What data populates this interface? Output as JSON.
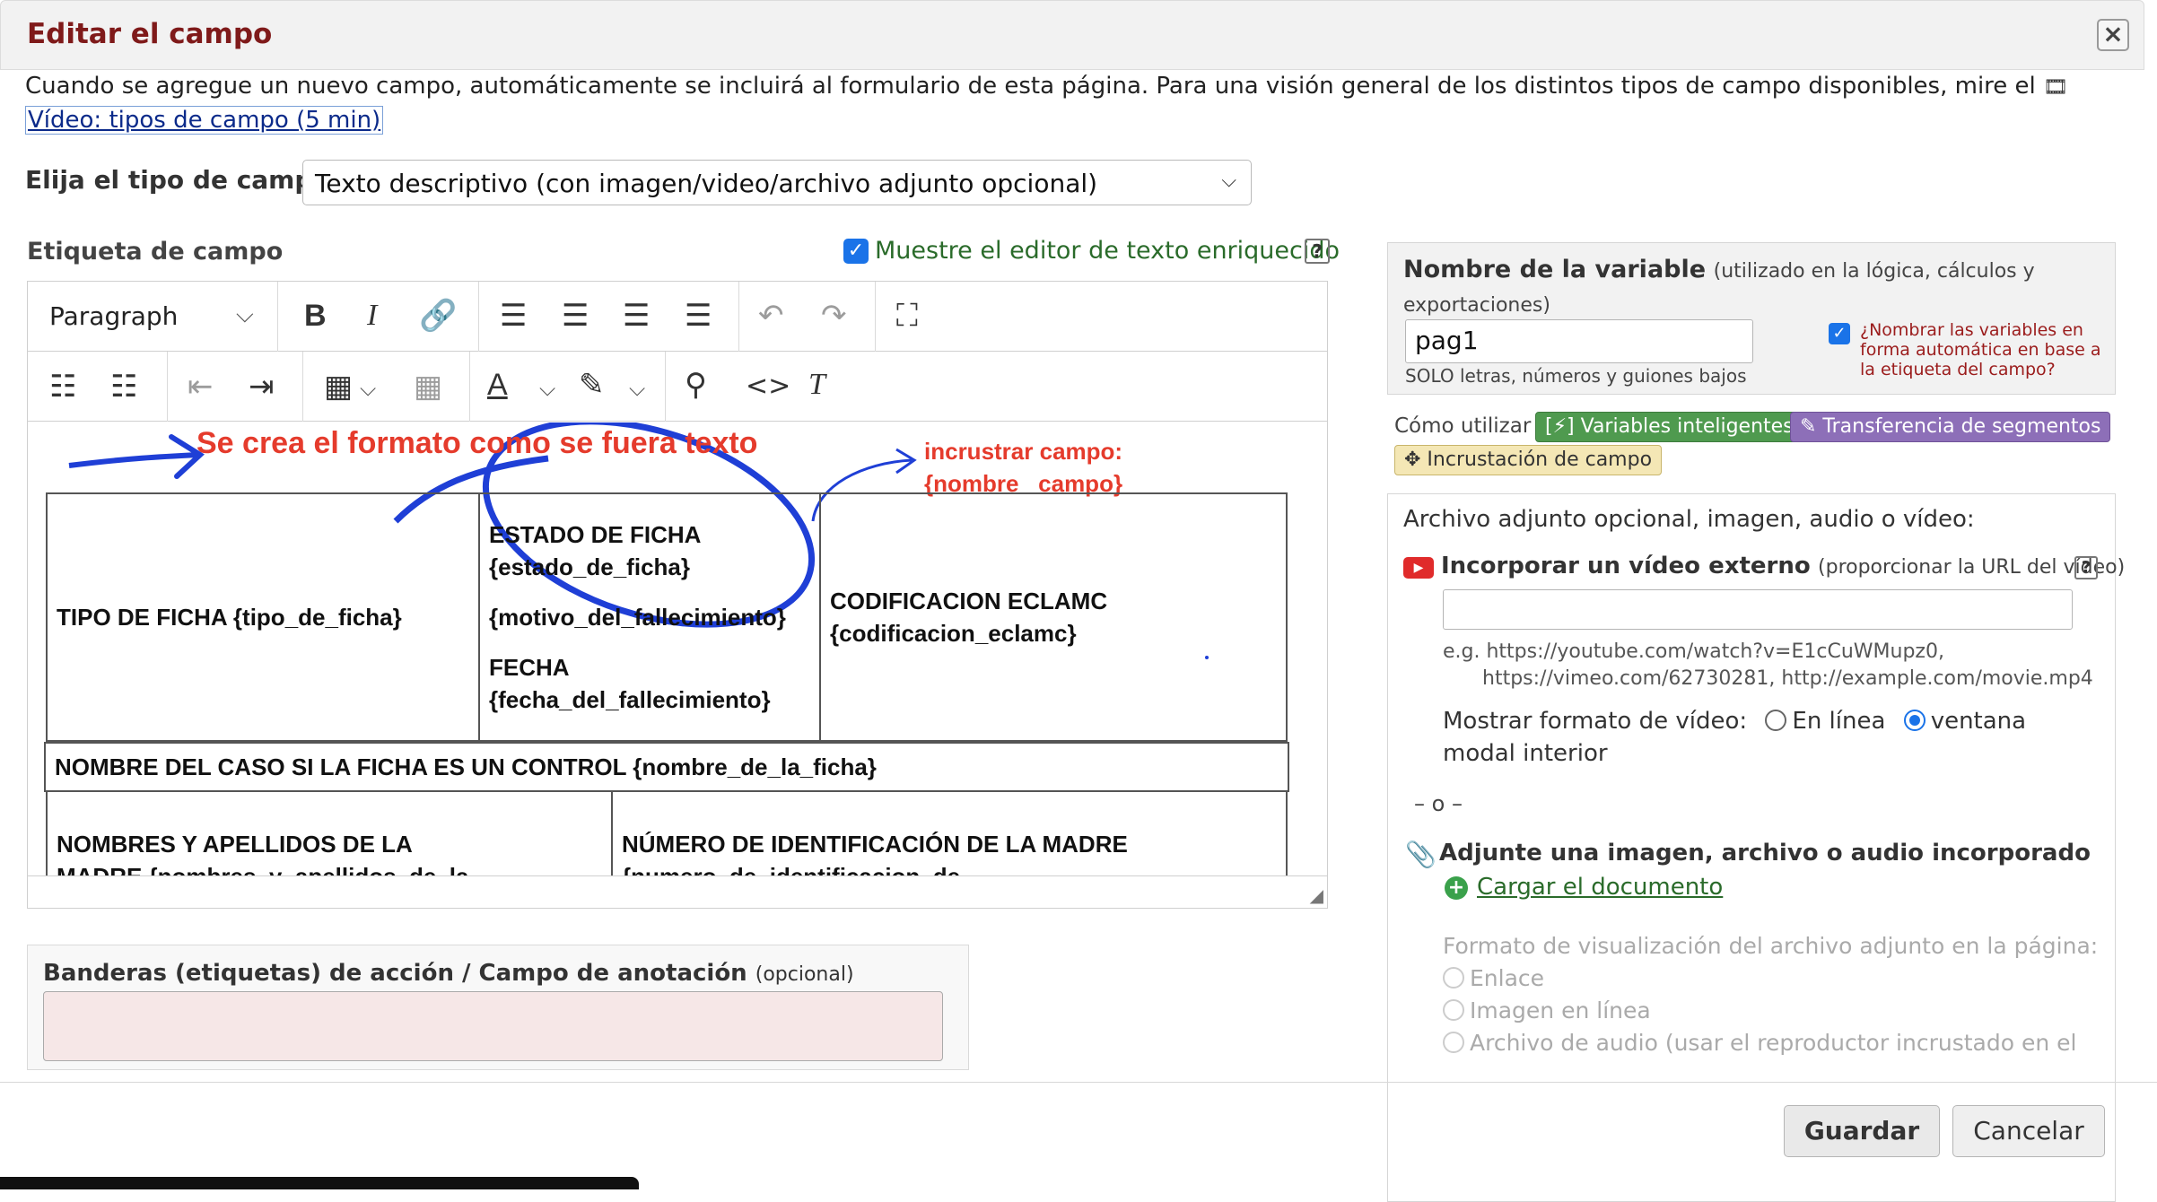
{
  "dialog": {
    "title": "Editar el campo",
    "close_glyph": "×",
    "intro_text": "Cuando se agregue un nuevo campo, automáticamente se incluirá al formulario de esta página. Para una visión general de los distintos tipos de campo disponibles, mire el ",
    "intro_link": "Vídeo: tipos de campo (5 min)"
  },
  "field_type": {
    "label": "Elija el tipo de campo",
    "selected": "Texto descriptivo (con imagen/video/archivo adjunto opcional)"
  },
  "field_label": {
    "heading": "Etiqueta de campo",
    "rich_text_label": "Muestre el editor de texto enriquecido",
    "rich_text_checked": true,
    "help": "?"
  },
  "editor": {
    "block_format": "Paragraph",
    "annotations": {
      "format_note": "Se crea el formato como se fuera texto",
      "embed_note_line1": "incrustrar campo:",
      "embed_note_line2": "{nombre_ campo}"
    },
    "table": {
      "row1": {
        "tipo": "TIPO DE FICHA {tipo_de_ficha}",
        "estado_line1": "ESTADO DE FICHA",
        "estado_line2": "{estado_de_ficha}",
        "motivo": "{motivo_del_fallecimiento}",
        "fecha_line1": "FECHA",
        "fecha_line2": "{fecha_del_fallecimiento}",
        "codif_line1": "CODIFICACION ECLAMC",
        "codif_line2": "{codificacion_eclamc}"
      },
      "row2": "NOMBRE DEL CASO SI LA FICHA ES UN CONTROL {nombre_de_la_ficha}",
      "row3": {
        "left_line1": "NOMBRES Y APELLIDOS DE LA",
        "left_line2": "MADRE {nombres_y_apellidos_de_la",
        "right_line1": "NÚMERO DE IDENTIFICACIÓN DE LA MADRE",
        "right_line2": "{numero_de_identificacion_de"
      }
    }
  },
  "action_tags": {
    "label": "Banderas (etiquetas) de acción / Campo de anotación",
    "optional": "(opcional)",
    "value": ""
  },
  "variable": {
    "label": "Nombre de la variable",
    "sublabel": "(utilizado en la lógica, cálculos y exportaciones)",
    "value": "pag1",
    "hint": "SOLO letras, números y guiones bajos",
    "auto_label": "¿Nombrar las variables en forma automática en base a la etiqueta del campo?",
    "auto_checked": true
  },
  "how_to": {
    "label": "Cómo utilizar",
    "smart_vars": "[⚡] Variables inteligentes",
    "piping": "✎ Transferencia de segmentos",
    "embedding": "✥ Incrustación de campo"
  },
  "attachment": {
    "title": "Archivo adjunto opcional, imagen, audio o vídeo:",
    "video_label": "Incorporar un vídeo externo",
    "video_sublabel": "(proporcionar la URL del vídeo)",
    "video_value": "",
    "example_line1": "e.g. https://youtube.com/watch?v=E1cCuWMupz0,",
    "example_line2": "https://vimeo.com/62730281, http://example.com/movie.mp4",
    "format_label": "Mostrar formato de vídeo:",
    "format_inline": "En línea",
    "format_modal": "ventana modal interior",
    "format_selected": "modal",
    "or": "– o –",
    "upload_title": "Adjunte una imagen, archivo o audio incorporado",
    "upload_link": "Cargar el documento",
    "display_label": "Formato de visualización del archivo adjunto en la página:",
    "display_link": "Enlace",
    "display_image": "Imagen en línea",
    "display_audio": "Archivo de audio (usar el reproductor incrustado en el"
  },
  "footer": {
    "save": "Guardar",
    "cancel": "Cancelar"
  },
  "colors": {
    "title": "#7f1a1a",
    "accent": "#1a73e8",
    "annotation_red": "#e53b2c",
    "annotation_blue": "#1f3fd6"
  }
}
